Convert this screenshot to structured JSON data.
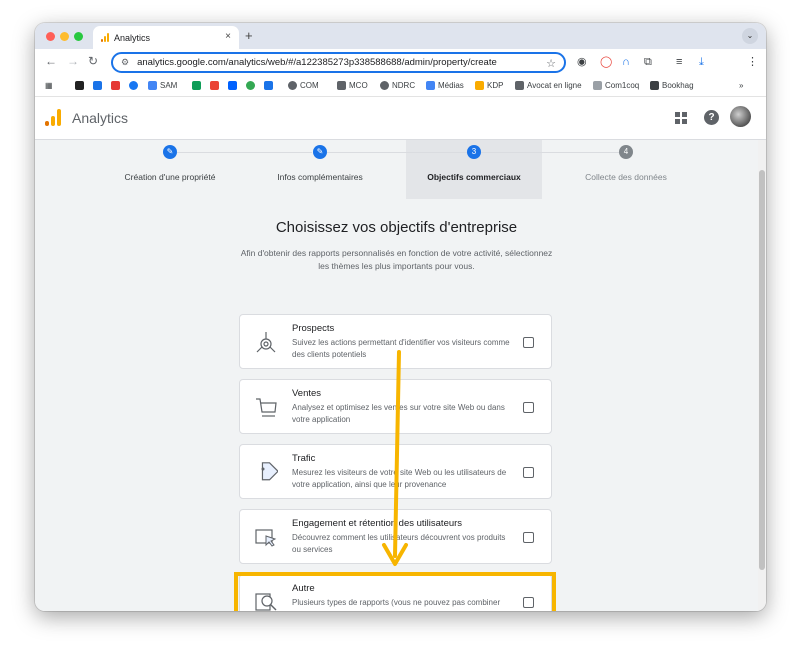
{
  "browser": {
    "tab_title": "Analytics",
    "tab_close": "×",
    "new_tab": "+",
    "tab_menu": "⌄",
    "url": "analytics.google.com/analytics/web/#/a122385273p338588688/admin/property/create"
  },
  "bookmarks": [
    {
      "label": "SAM",
      "color": "#4285f4"
    },
    {
      "label": "COM",
      "color": "#5f6368"
    },
    {
      "label": "MCO",
      "color": "#5f6368"
    },
    {
      "label": "NDRC",
      "color": "#5f6368"
    },
    {
      "label": "Médias",
      "color": "#4285f4"
    },
    {
      "label": "KDP",
      "color": "#f9ab00"
    },
    {
      "label": "Avocat en ligne",
      "color": "#5f6368"
    },
    {
      "label": "Com1coq",
      "color": "#9aa0a6"
    },
    {
      "label": "Bookhag",
      "color": "#3c4043"
    }
  ],
  "app": {
    "name": "Analytics",
    "help": "?"
  },
  "stepper": {
    "steps": [
      {
        "num": "✎",
        "label": "Création d'une propriété",
        "state": "done"
      },
      {
        "num": "✎",
        "label": "Infos complémentaires",
        "state": "done"
      },
      {
        "num": "3",
        "label": "Objectifs commerciaux",
        "state": "active"
      },
      {
        "num": "4",
        "label": "Collecte des données",
        "state": "pending"
      }
    ]
  },
  "page": {
    "title": "Choisissez vos objectifs d'entreprise",
    "subtitle": "Afin d'obtenir des rapports personnalisés en fonction de votre activité, sélectionnez les thèmes les plus importants pour vous."
  },
  "objectives": [
    {
      "icon": "target-icon",
      "title": "Prospects",
      "desc": "Suivez les actions permettant d'identifier vos visiteurs comme des clients potentiels",
      "checked": false
    },
    {
      "icon": "cart-icon",
      "title": "Ventes",
      "desc": "Analysez et optimisez les ventes sur votre site Web ou dans votre application",
      "checked": false
    },
    {
      "icon": "tag-icon",
      "title": "Trafic",
      "desc": "Mesurez les visiteurs de votre site Web ou les utilisateurs de votre application, ainsi que leur provenance",
      "checked": false
    },
    {
      "icon": "engagement-icon",
      "title": "Engagement et rétention des utilisateurs",
      "desc": "Découvrez comment les utilisateurs découvrent vos produits ou services",
      "checked": false
    },
    {
      "icon": "magnifier-icon",
      "title": "Autre",
      "desc": "Plusieurs types de rapports (vous ne pouvez pas combiner cette option avec d'autres)",
      "checked": false
    }
  ],
  "colors": {
    "accent": "#1a73e8",
    "highlight": "#f7b500",
    "arrow": "#f7b500"
  }
}
